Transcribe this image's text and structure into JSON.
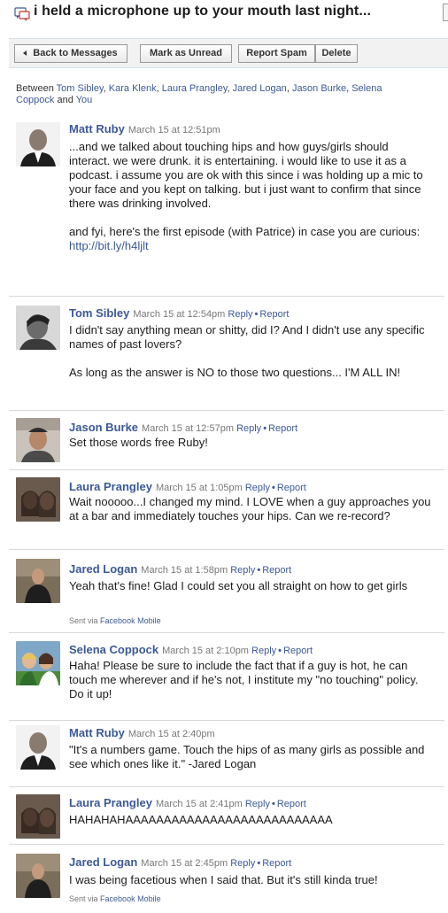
{
  "header": {
    "title": "i held a microphone up to your mouth last night..."
  },
  "toolbar": {
    "back_label": "Back to Messages",
    "unread_label": "Mark as Unread",
    "spam_label": "Report Spam",
    "delete_label": "Delete"
  },
  "participants": {
    "prefix": "Between",
    "names": [
      "Tom Sibley",
      "Kara Klenk",
      "Laura Prangley",
      "Jared Logan",
      "Jason Burke",
      "Selena Coppock"
    ],
    "and_label": "and",
    "you_label": "You"
  },
  "labels": {
    "reply": "Reply",
    "report": "Report",
    "bullet": "•",
    "sent_via_prefix": "Sent via",
    "sent_via_app": "Facebook Mobile"
  },
  "messages": [
    {
      "author": "Matt Ruby",
      "timestamp": "March 15 at 12:51pm",
      "paragraphs": [
        "...and we talked about touching hips and how guys/girls should interact. we were drunk. it is entertaining. i would like to use it as a podcast. i assume you are ok with this since i was holding up a mic to your face and you kept on talking. but i just want to confirm that since there was drinking involved.",
        "and fyi, here's the first episode (with Patrice) in case you are curious:"
      ],
      "link": "http://bit.ly/h4ljlt"
    },
    {
      "author": "Tom Sibley",
      "timestamp": "March 15 at 12:54pm",
      "paragraphs": [
        "I didn't say anything mean or shitty, did I? And I didn't use any specific names of past lovers?",
        "As long as the answer is NO to those two questions... I'M ALL IN!"
      ]
    },
    {
      "author": "Jason Burke",
      "timestamp": "March 15 at 12:57pm",
      "paragraphs": [
        "Set those words free Ruby!"
      ]
    },
    {
      "author": "Laura Prangley",
      "timestamp": "March 15 at 1:05pm",
      "paragraphs": [
        "Wait nooooo...I changed my mind. I LOVE when a guy approaches you at a bar and immediately touches your hips. Can we re-record?"
      ]
    },
    {
      "author": "Jared Logan",
      "timestamp": "March 15 at 1:58pm",
      "paragraphs": [
        "Yeah that's fine! Glad I could set you all straight on how to get girls"
      ]
    },
    {
      "author": "Selena Coppock",
      "timestamp": "March 15 at 2:10pm",
      "paragraphs": [
        "Haha! Please be sure to include the fact that if a guy is hot, he can touch me wherever and if he's not, I institute my \"no touching\" policy. Do it up!"
      ]
    },
    {
      "author": "Matt Ruby",
      "timestamp": "March 15 at 2:40pm",
      "paragraphs": [
        "\"It's a numbers game. Touch the hips of as many girls as possible and see which ones like it.\" -Jared Logan"
      ]
    },
    {
      "author": "Laura Prangley",
      "timestamp": "March 15 at 2:41pm",
      "paragraphs": [
        "HAHAHAHAAAAAAAAAAAAAAAAAAAAAAAAAAA"
      ]
    },
    {
      "author": "Jared Logan",
      "timestamp": "March 15 at 2:45pm",
      "paragraphs": [
        "I was being facetious when I said that. But it's still kinda true!"
      ]
    }
  ]
}
